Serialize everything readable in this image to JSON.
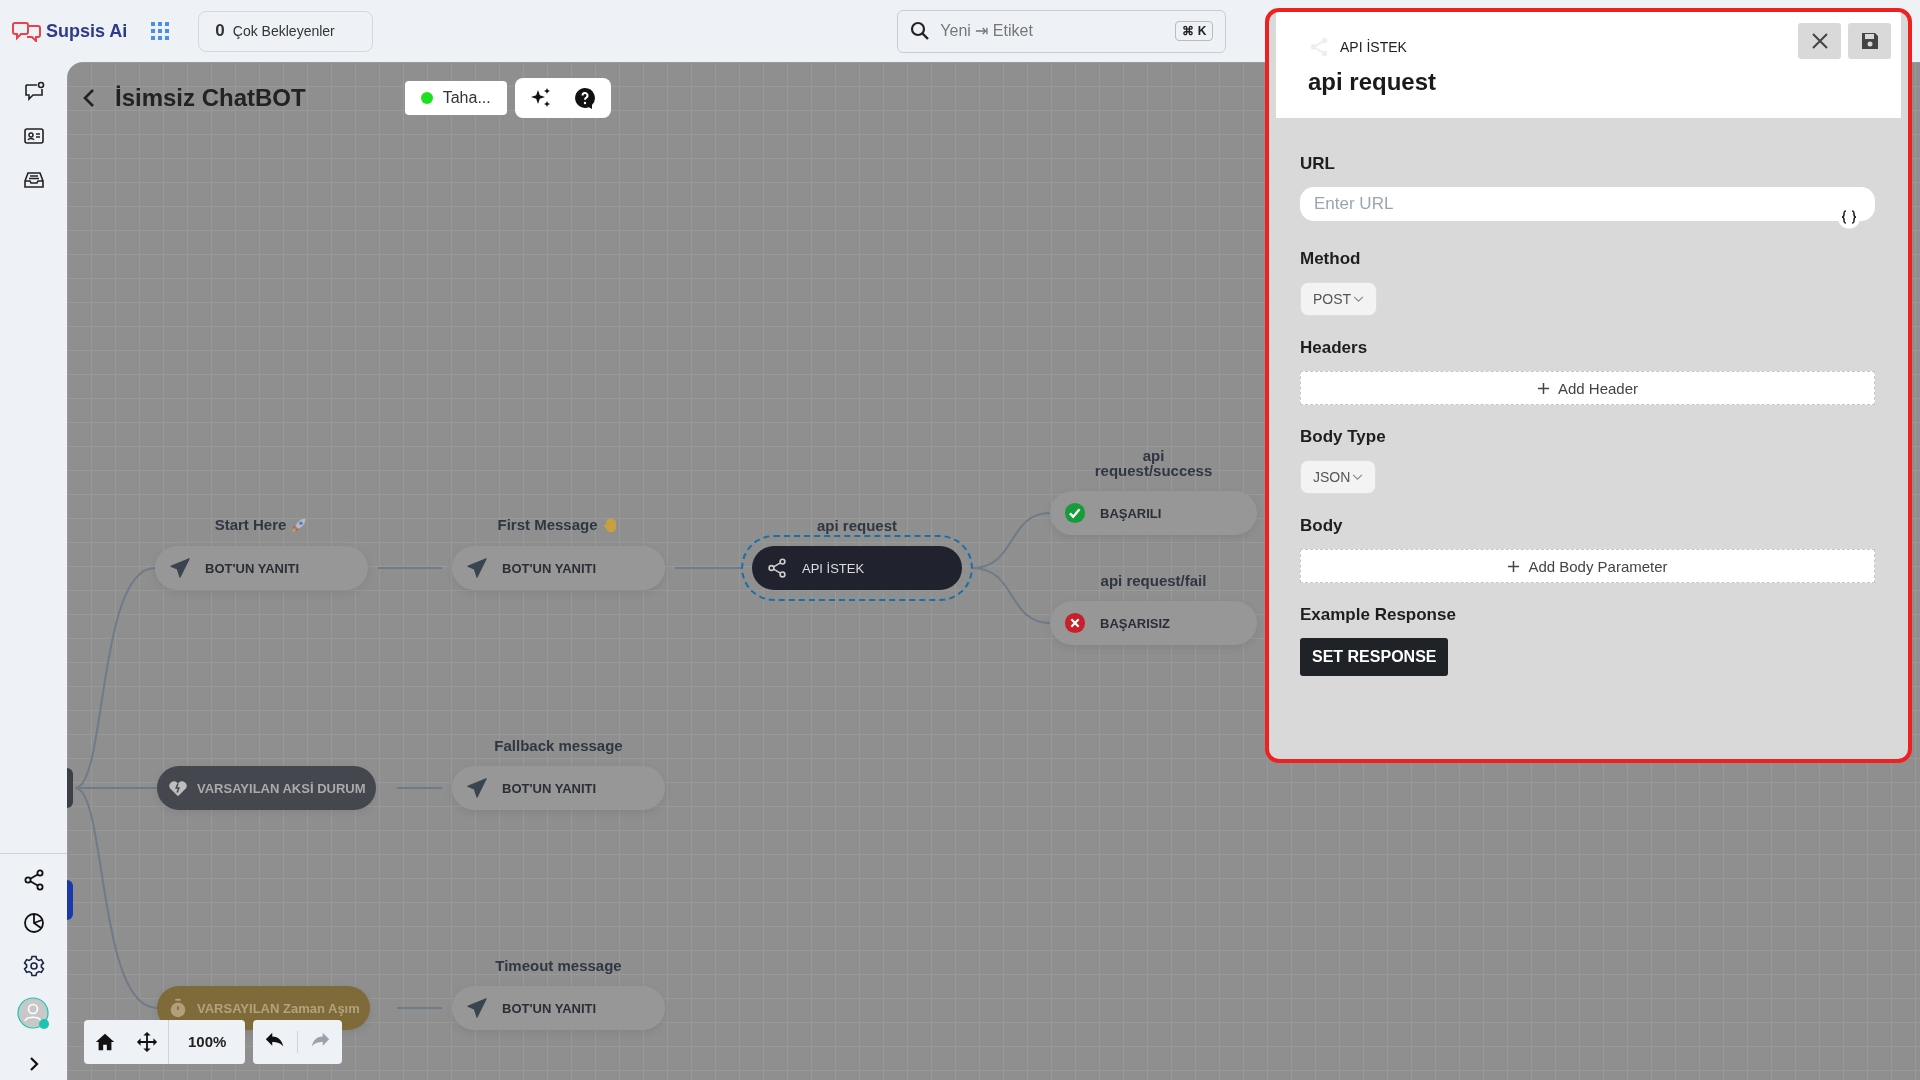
{
  "topbar": {
    "logo": "Supsis Ai",
    "pending": {
      "count": "0",
      "label": "Çok Bekleyenler"
    },
    "search": {
      "placeholder": "Yeni ⇥ Etiket",
      "shortcut": "⌘ K"
    }
  },
  "flow": {
    "title": "İsimsiz ChatBOT",
    "agent": {
      "label": "Taha...",
      "online": true
    }
  },
  "nodes": [
    {
      "kind": "message",
      "caption": "Start Here",
      "text": "BOT'UN YANITI",
      "selected": false
    },
    {
      "kind": "message",
      "caption": "First Message",
      "text": "BOT'UN YANITI",
      "selected": false
    },
    {
      "kind": "api",
      "caption": "api request",
      "text": "API İSTEK",
      "selected": true
    },
    {
      "kind": "success",
      "caption": "api request/success",
      "text": "BAŞARILI",
      "selected": false
    },
    {
      "kind": "fail",
      "caption": "api request/fail",
      "text": "BAŞARISIZ",
      "selected": false
    },
    {
      "kind": "fallback",
      "text": "VARSAYILAN AKSİ DURUM",
      "selected": false
    },
    {
      "kind": "message",
      "caption": "Fallback message",
      "text": "BOT'UN YANITI",
      "selected": false
    },
    {
      "kind": "timeout",
      "text": "VARSAYILAN Zaman Aşım",
      "selected": false
    },
    {
      "kind": "message",
      "caption": "Timeout message",
      "text": "BOT'UN YANITI",
      "selected": false
    }
  ],
  "controls": {
    "zoom": "100%",
    "undo_disabled": false,
    "redo_disabled": true
  },
  "panel": {
    "type": "API İSTEK",
    "title": "api request",
    "fields": [
      {
        "kind": "input",
        "label": "URL",
        "placeholder": "Enter URL"
      },
      {
        "kind": "select",
        "label": "Method",
        "value": "POST"
      },
      {
        "kind": "add",
        "label": "Headers",
        "action": "Add Header"
      },
      {
        "kind": "select",
        "label": "Body Type",
        "value": "JSON"
      },
      {
        "kind": "add",
        "label": "Body",
        "action": "Add Body Parameter"
      },
      {
        "kind": "button",
        "label": "Example Response",
        "action": "SET RESPONSE"
      }
    ]
  }
}
